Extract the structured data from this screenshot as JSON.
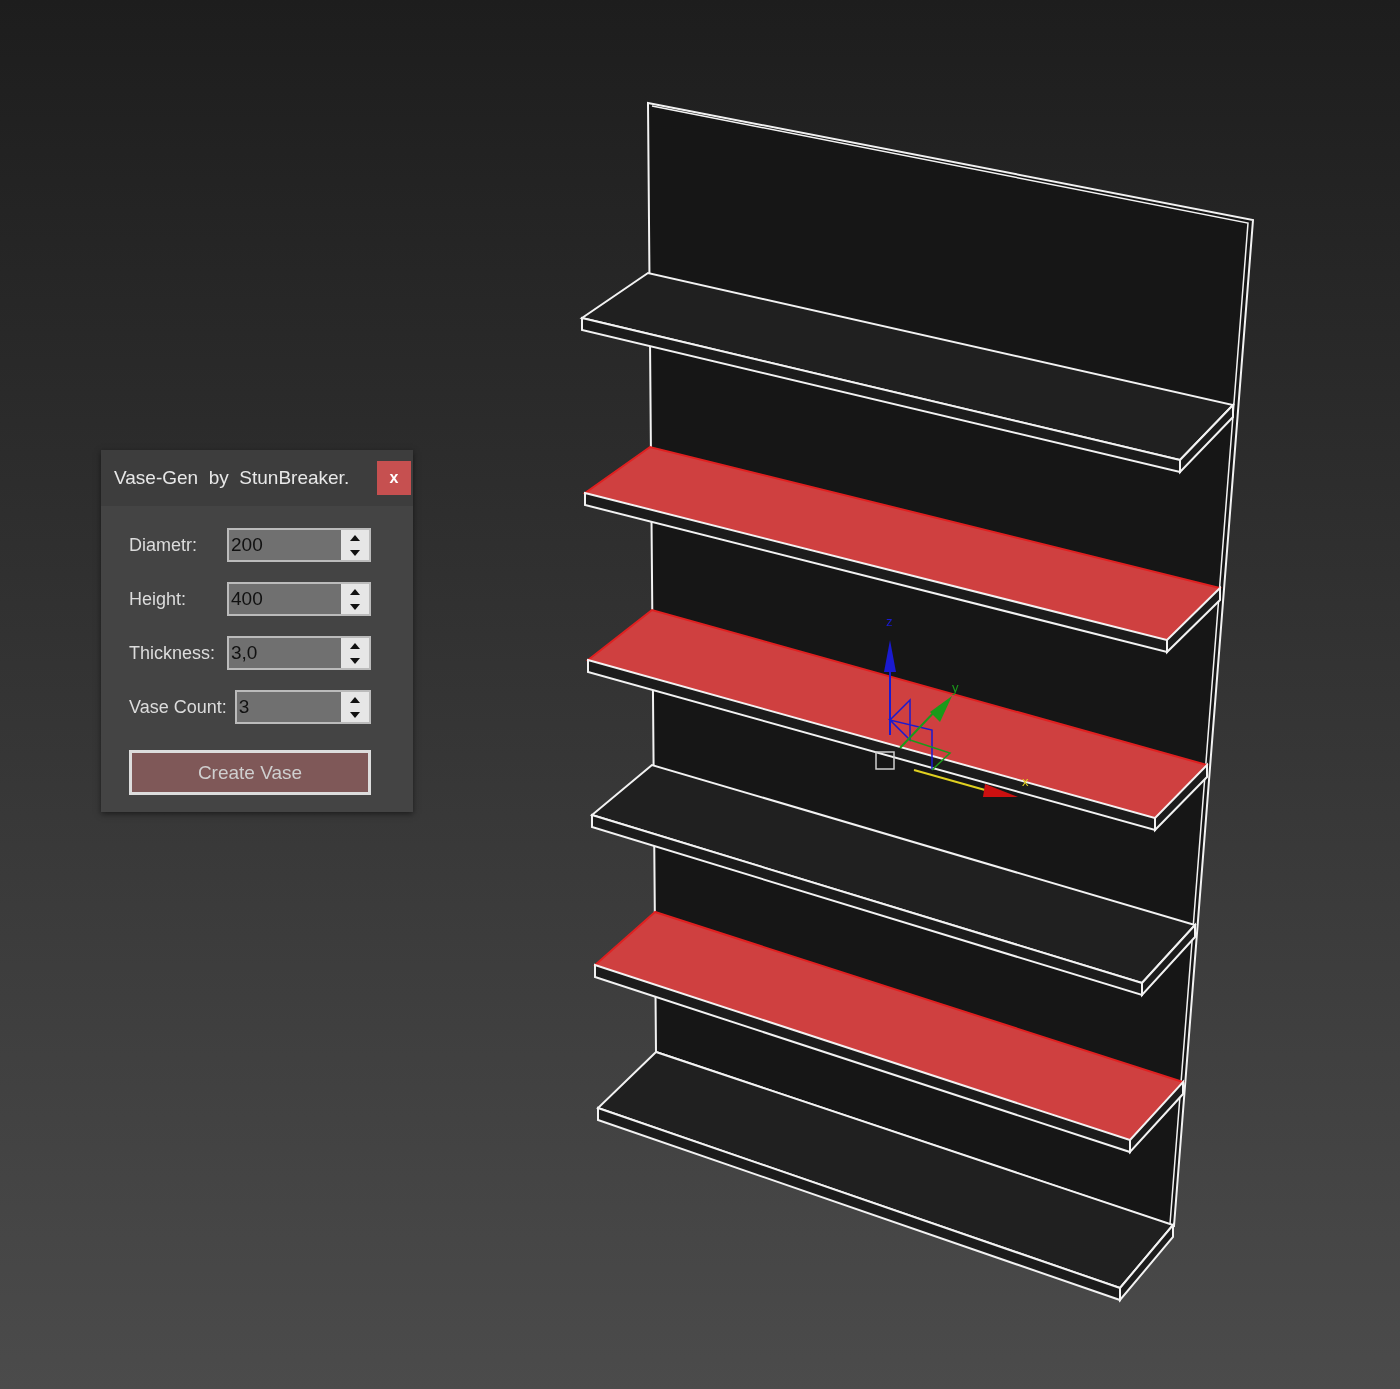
{
  "dialog": {
    "title": "Vase-Gen  by  StunBreaker.",
    "close_label": "x",
    "fields": [
      {
        "label": "Diametr:",
        "value": "200"
      },
      {
        "label": "Height:",
        "value": "400"
      },
      {
        "label": "Thickness:",
        "value": "3,0"
      },
      {
        "label": "Vase Count:",
        "value": "3"
      }
    ],
    "button": "Create Vase"
  },
  "viewport": {
    "shelves": [
      {
        "selected": false
      },
      {
        "selected": true
      },
      {
        "selected": true
      },
      {
        "selected": false
      },
      {
        "selected": true
      },
      {
        "selected": false
      }
    ],
    "gizmo_labels": [
      {
        "text": "z"
      },
      {
        "text": "y"
      },
      {
        "text": "x"
      }
    ]
  }
}
